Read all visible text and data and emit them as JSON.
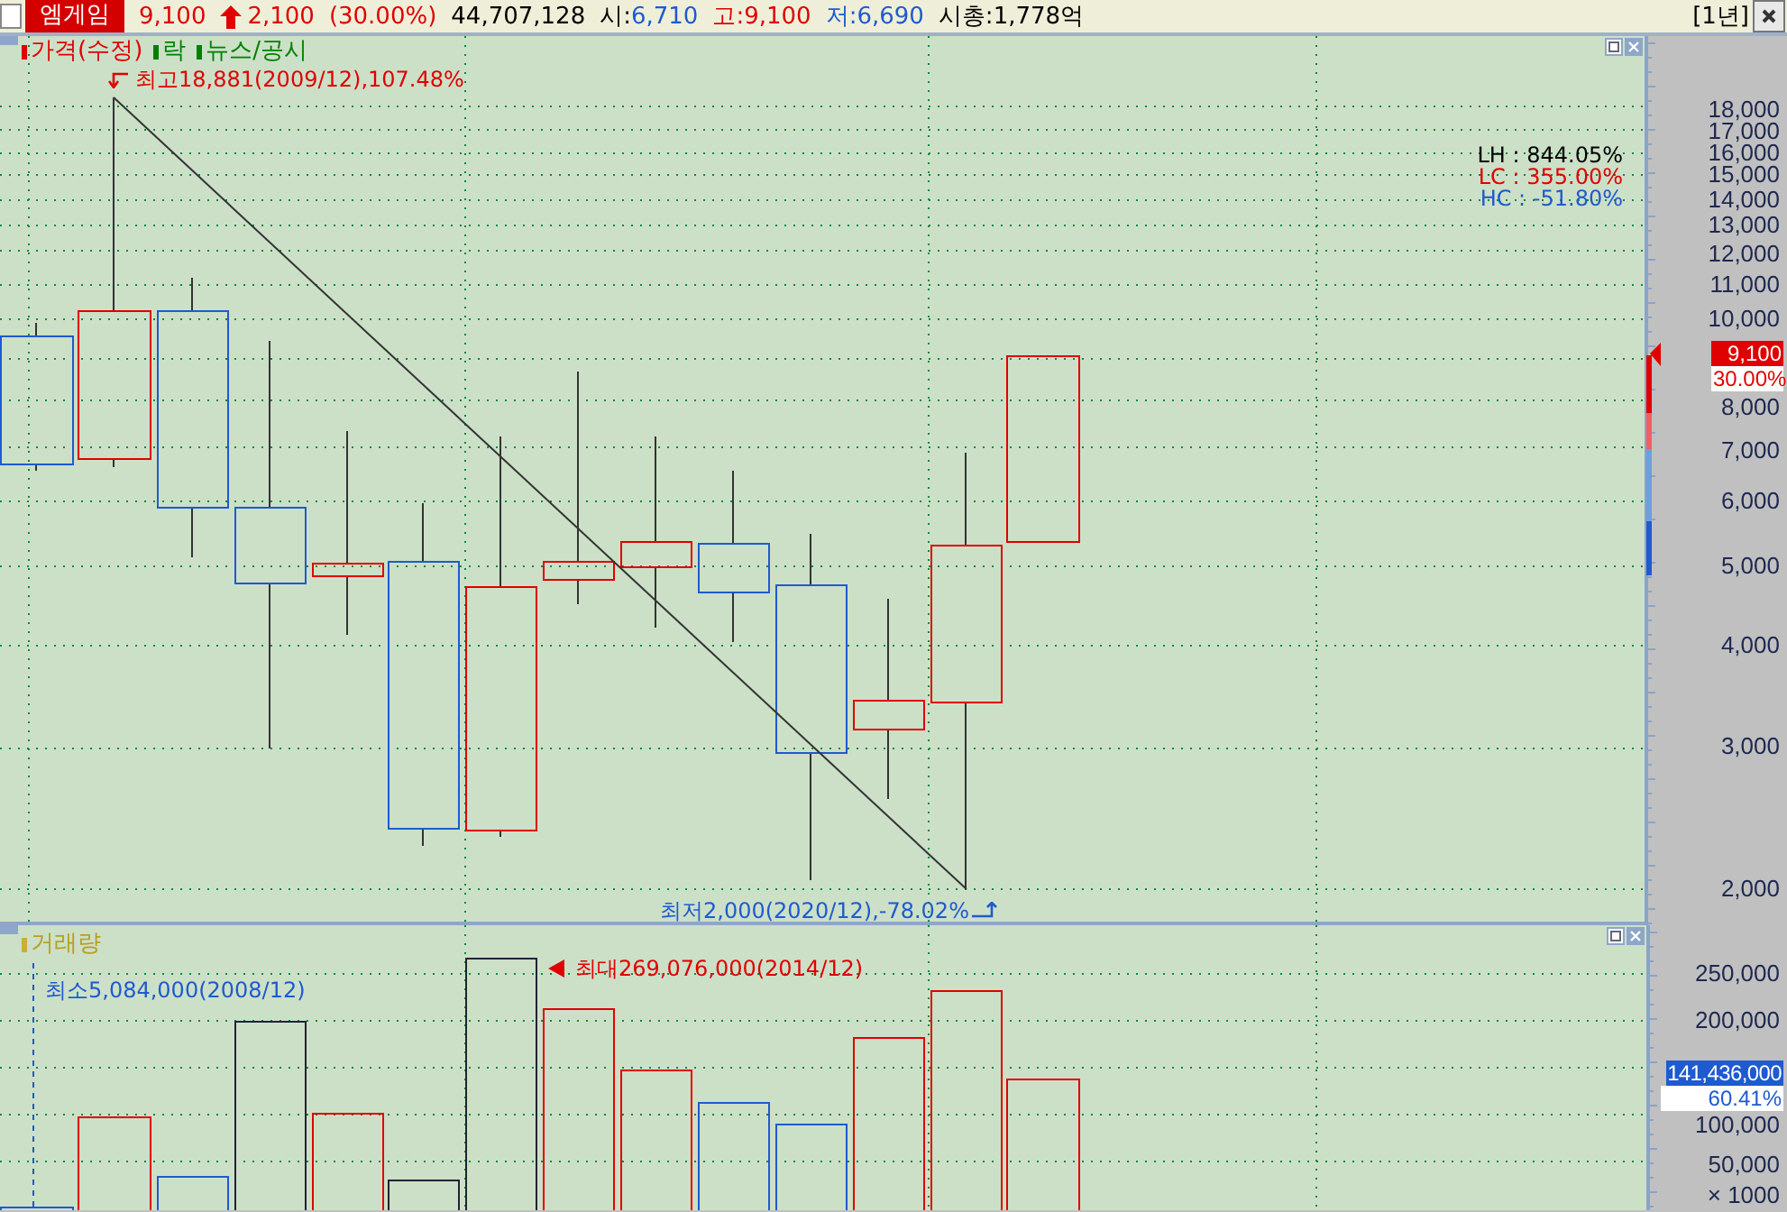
{
  "header": {
    "checked": false,
    "name": "엠게임",
    "price": "9,100",
    "rising": true,
    "change": "2,100",
    "change_pct": "(30.00%)",
    "volume": "44,707,128",
    "stats": [
      {
        "kind": "open",
        "label": "시:",
        "value": "6,710"
      },
      {
        "kind": "high",
        "label": "고:",
        "value": "9,100"
      },
      {
        "kind": "low",
        "label": "저:",
        "value": "6,690"
      },
      {
        "kind": "cap",
        "label": "시총:",
        "value": "1,778억"
      }
    ],
    "period": "[1년]"
  },
  "price_panel": {
    "legend": [
      {
        "label": "가격(수정)",
        "color": "#e00000"
      },
      {
        "label": "락",
        "color": "#008000"
      },
      {
        "label": "뉴스/공시",
        "color": "#008000"
      }
    ],
    "high_note": "최고18,881(2009/12),107.48%",
    "low_note": "최저2,000(2020/12),-78.02%",
    "ratios": [
      {
        "text": "LH : 844.05%",
        "color": "#000000"
      },
      {
        "text": "LC : 355.00%",
        "color": "#e00000"
      },
      {
        "text": "HC : -51.80%",
        "color": "#1e5ad0"
      }
    ],
    "axis_labels": [
      "18,000",
      "17,000",
      "16,000",
      "15,000",
      "14,000",
      "13,000",
      "12,000",
      "11,000",
      "10,000",
      "8,000",
      "7,000",
      "6,000",
      "5,000",
      "4,000",
      "3,000",
      "2,000"
    ],
    "price_tag": "9,100",
    "pct_tag": "30.00%"
  },
  "volume_panel": {
    "title": "거래량",
    "min_note": "최소5,084,000(2008/12)",
    "max_note": "최대269,076,000(2014/12)",
    "axis_labels": [
      "250,000",
      "200,000",
      "100,000",
      "50,000"
    ],
    "unit": "× 1000",
    "volume_tag": "141,436,000",
    "pct_tag": "60.41%"
  }
}
